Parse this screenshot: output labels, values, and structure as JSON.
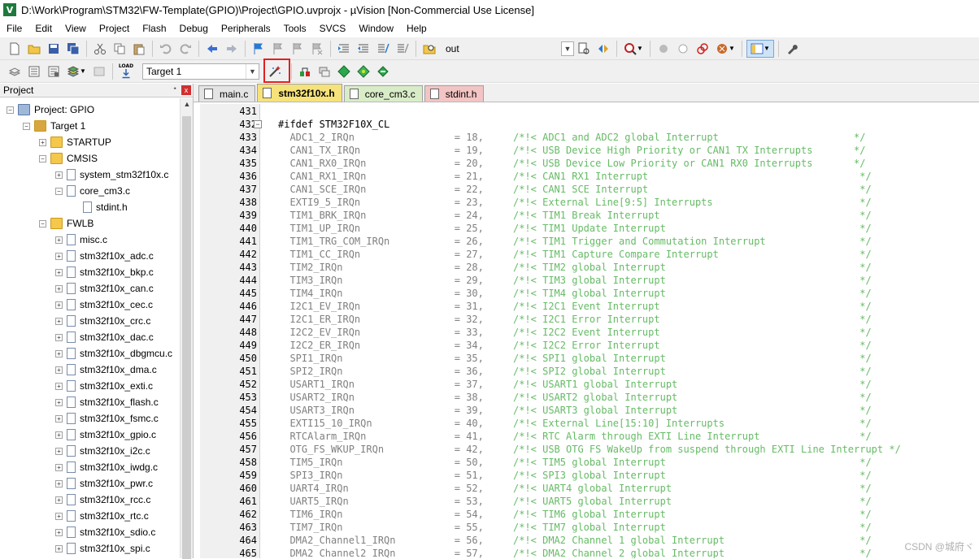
{
  "window": {
    "title": "D:\\Work\\Program\\STM32\\FW-Template(GPIO)\\Project\\GPIO.uvprojx - µVision  [Non-Commercial Use License]"
  },
  "menu": [
    "File",
    "Edit",
    "View",
    "Project",
    "Flash",
    "Debug",
    "Peripherals",
    "Tools",
    "SVCS",
    "Window",
    "Help"
  ],
  "toolbar1": {
    "find_combo_value": "out"
  },
  "toolbar2": {
    "target_combo_value": "Target 1",
    "load_label": "LOAD"
  },
  "project_panel": {
    "title": "Project",
    "pin": "ᐩ",
    "close": "x",
    "tree": [
      {
        "label": "Project: GPIO",
        "level": 0,
        "type": "project",
        "expander": "−"
      },
      {
        "label": "Target 1",
        "level": 1,
        "type": "target",
        "expander": "−"
      },
      {
        "label": "STARTUP",
        "level": 2,
        "type": "folder",
        "expander": "+"
      },
      {
        "label": "CMSIS",
        "level": 2,
        "type": "folder",
        "expander": "−"
      },
      {
        "label": "system_stm32f10x.c",
        "level": 3,
        "type": "file",
        "expander": "+"
      },
      {
        "label": "core_cm3.c",
        "level": 3,
        "type": "file",
        "expander": "−"
      },
      {
        "label": "stdint.h",
        "level": 4,
        "type": "file",
        "expander": ""
      },
      {
        "label": "FWLB",
        "level": 2,
        "type": "folder",
        "expander": "−"
      },
      {
        "label": "misc.c",
        "level": 3,
        "type": "file",
        "expander": "+"
      },
      {
        "label": "stm32f10x_adc.c",
        "level": 3,
        "type": "file",
        "expander": "+"
      },
      {
        "label": "stm32f10x_bkp.c",
        "level": 3,
        "type": "file",
        "expander": "+"
      },
      {
        "label": "stm32f10x_can.c",
        "level": 3,
        "type": "file",
        "expander": "+"
      },
      {
        "label": "stm32f10x_cec.c",
        "level": 3,
        "type": "file",
        "expander": "+"
      },
      {
        "label": "stm32f10x_crc.c",
        "level": 3,
        "type": "file",
        "expander": "+"
      },
      {
        "label": "stm32f10x_dac.c",
        "level": 3,
        "type": "file",
        "expander": "+"
      },
      {
        "label": "stm32f10x_dbgmcu.c",
        "level": 3,
        "type": "file",
        "expander": "+"
      },
      {
        "label": "stm32f10x_dma.c",
        "level": 3,
        "type": "file",
        "expander": "+"
      },
      {
        "label": "stm32f10x_exti.c",
        "level": 3,
        "type": "file",
        "expander": "+"
      },
      {
        "label": "stm32f10x_flash.c",
        "level": 3,
        "type": "file",
        "expander": "+"
      },
      {
        "label": "stm32f10x_fsmc.c",
        "level": 3,
        "type": "file",
        "expander": "+"
      },
      {
        "label": "stm32f10x_gpio.c",
        "level": 3,
        "type": "file",
        "expander": "+"
      },
      {
        "label": "stm32f10x_i2c.c",
        "level": 3,
        "type": "file",
        "expander": "+"
      },
      {
        "label": "stm32f10x_iwdg.c",
        "level": 3,
        "type": "file",
        "expander": "+"
      },
      {
        "label": "stm32f10x_pwr.c",
        "level": 3,
        "type": "file",
        "expander": "+"
      },
      {
        "label": "stm32f10x_rcc.c",
        "level": 3,
        "type": "file",
        "expander": "+"
      },
      {
        "label": "stm32f10x_rtc.c",
        "level": 3,
        "type": "file",
        "expander": "+"
      },
      {
        "label": "stm32f10x_sdio.c",
        "level": 3,
        "type": "file",
        "expander": "+"
      },
      {
        "label": "stm32f10x_spi.c",
        "level": 3,
        "type": "file",
        "expander": "+"
      }
    ]
  },
  "tabs": [
    {
      "label": "main.c",
      "color": "#e4e4e4",
      "active": false
    },
    {
      "label": "stm32f10x.h",
      "color": "#f5e27a",
      "active": true
    },
    {
      "label": "core_cm3.c",
      "color": "#d9ecc8",
      "active": false
    },
    {
      "label": "stdint.h",
      "color": "#f3c4c4",
      "active": false
    }
  ],
  "code": {
    "lines": [
      {
        "n": "431",
        "text": "",
        "comment": ""
      },
      {
        "n": "432",
        "text": "#ifdef STM32F10X_CL",
        "comment": "",
        "pp": true,
        "fold": "−"
      },
      {
        "n": "433",
        "text": "  ADC1_2_IRQn                 = 18,     ",
        "comment": "/*!< ADC1 and ADC2 global Interrupt                       */"
      },
      {
        "n": "434",
        "text": "  CAN1_TX_IRQn                = 19,     ",
        "comment": "/*!< USB Device High Priority or CAN1 TX Interrupts       */"
      },
      {
        "n": "435",
        "text": "  CAN1_RX0_IRQn               = 20,     ",
        "comment": "/*!< USB Device Low Priority or CAN1 RX0 Interrupts       */"
      },
      {
        "n": "436",
        "text": "  CAN1_RX1_IRQn               = 21,     ",
        "comment": "/*!< CAN1 RX1 Interrupt                                    */"
      },
      {
        "n": "437",
        "text": "  CAN1_SCE_IRQn               = 22,     ",
        "comment": "/*!< CAN1 SCE Interrupt                                    */"
      },
      {
        "n": "438",
        "text": "  EXTI9_5_IRQn                = 23,     ",
        "comment": "/*!< External Line[9:5] Interrupts                         */"
      },
      {
        "n": "439",
        "text": "  TIM1_BRK_IRQn               = 24,     ",
        "comment": "/*!< TIM1 Break Interrupt                                  */"
      },
      {
        "n": "440",
        "text": "  TIM1_UP_IRQn                = 25,     ",
        "comment": "/*!< TIM1 Update Interrupt                                 */"
      },
      {
        "n": "441",
        "text": "  TIM1_TRG_COM_IRQn           = 26,     ",
        "comment": "/*!< TIM1 Trigger and Commutation Interrupt                */"
      },
      {
        "n": "442",
        "text": "  TIM1_CC_IRQn                = 27,     ",
        "comment": "/*!< TIM1 Capture Compare Interrupt                        */"
      },
      {
        "n": "443",
        "text": "  TIM2_IRQn                   = 28,     ",
        "comment": "/*!< TIM2 global Interrupt                                 */"
      },
      {
        "n": "444",
        "text": "  TIM3_IRQn                   = 29,     ",
        "comment": "/*!< TIM3 global Interrupt                                 */"
      },
      {
        "n": "445",
        "text": "  TIM4_IRQn                   = 30,     ",
        "comment": "/*!< TIM4 global Interrupt                                 */"
      },
      {
        "n": "446",
        "text": "  I2C1_EV_IRQn                = 31,     ",
        "comment": "/*!< I2C1 Event Interrupt                                  */"
      },
      {
        "n": "447",
        "text": "  I2C1_ER_IRQn                = 32,     ",
        "comment": "/*!< I2C1 Error Interrupt                                  */"
      },
      {
        "n": "448",
        "text": "  I2C2_EV_IRQn                = 33,     ",
        "comment": "/*!< I2C2 Event Interrupt                                  */"
      },
      {
        "n": "449",
        "text": "  I2C2_ER_IRQn                = 34,     ",
        "comment": "/*!< I2C2 Error Interrupt                                  */"
      },
      {
        "n": "450",
        "text": "  SPI1_IRQn                   = 35,     ",
        "comment": "/*!< SPI1 global Interrupt                                 */"
      },
      {
        "n": "451",
        "text": "  SPI2_IRQn                   = 36,     ",
        "comment": "/*!< SPI2 global Interrupt                                 */"
      },
      {
        "n": "452",
        "text": "  USART1_IRQn                 = 37,     ",
        "comment": "/*!< USART1 global Interrupt                               */"
      },
      {
        "n": "453",
        "text": "  USART2_IRQn                 = 38,     ",
        "comment": "/*!< USART2 global Interrupt                               */"
      },
      {
        "n": "454",
        "text": "  USART3_IRQn                 = 39,     ",
        "comment": "/*!< USART3 global Interrupt                               */"
      },
      {
        "n": "455",
        "text": "  EXTI15_10_IRQn              = 40,     ",
        "comment": "/*!< External Line[15:10] Interrupts                       */"
      },
      {
        "n": "456",
        "text": "  RTCAlarm_IRQn               = 41,     ",
        "comment": "/*!< RTC Alarm through EXTI Line Interrupt                 */"
      },
      {
        "n": "457",
        "text": "  OTG_FS_WKUP_IRQn            = 42,     ",
        "comment": "/*!< USB OTG FS WakeUp from suspend through EXTI Line Interrupt */"
      },
      {
        "n": "458",
        "text": "  TIM5_IRQn                   = 50,     ",
        "comment": "/*!< TIM5 global Interrupt                                 */"
      },
      {
        "n": "459",
        "text": "  SPI3_IRQn                   = 51,     ",
        "comment": "/*!< SPI3 global Interrupt                                 */"
      },
      {
        "n": "460",
        "text": "  UART4_IRQn                  = 52,     ",
        "comment": "/*!< UART4 global Interrupt                                */"
      },
      {
        "n": "461",
        "text": "  UART5_IRQn                  = 53,     ",
        "comment": "/*!< UART5 global Interrupt                                */"
      },
      {
        "n": "462",
        "text": "  TIM6_IRQn                   = 54,     ",
        "comment": "/*!< TIM6 global Interrupt                                 */"
      },
      {
        "n": "463",
        "text": "  TIM7_IRQn                   = 55,     ",
        "comment": "/*!< TIM7 global Interrupt                                 */"
      },
      {
        "n": "464",
        "text": "  DMA2_Channel1_IRQn          = 56,     ",
        "comment": "/*!< DMA2 Channel 1 global Interrupt                       */"
      },
      {
        "n": "465",
        "text": "  DMA2_Channel2_IRQn          = 57,     ",
        "comment": "/*!< DMA2 Channel 2 global Interrupt                       */"
      }
    ]
  },
  "watermark": "CSDN @城府ヾ"
}
